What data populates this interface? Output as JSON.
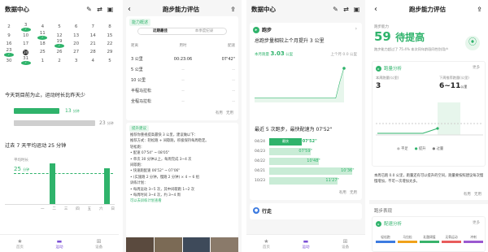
{
  "p1": {
    "title": "数据中心",
    "calendar": [
      [
        "2",
        "3",
        "4",
        "5",
        "6",
        "7",
        "8"
      ],
      [
        "9",
        "10",
        "11",
        "12",
        "13",
        "14",
        "15"
      ],
      [
        "16",
        "17",
        "18",
        "19",
        "20",
        "21",
        "22"
      ],
      [
        "23",
        "24",
        "25",
        "26",
        "27",
        "28",
        "29"
      ],
      [
        "30",
        "31",
        "1",
        "2",
        "3",
        "4",
        "5"
      ]
    ],
    "checked_days": [
      "3",
      "11",
      "19",
      "23",
      "31"
    ],
    "today": "24",
    "summary_text": "今天到目前为止，运动时长比昨天少",
    "today_label": "今日",
    "today_value": "13",
    "today_unit": "分钟",
    "yesterday_label": "昨日",
    "yesterday_value": "23",
    "yesterday_unit": "分钟",
    "week_title": "过去 7 天平均运动 25 分钟",
    "avg_label": "平均时长",
    "avg_value": "25",
    "avg_unit": "分钟",
    "weekdays": [
      "一",
      "二",
      "三",
      "四",
      "五",
      "六",
      "日"
    ],
    "nav": [
      "首页",
      "运动",
      "设备"
    ]
  },
  "p2": {
    "title": "跑步能力评估",
    "badge": "能力概述",
    "tabs": [
      "近期最佳",
      "本季度纪录"
    ],
    "col_headers": [
      "距离",
      "用时",
      "配速"
    ],
    "rows": [
      {
        "dist": "3 公里",
        "time": "00:23:06",
        "pace": "07'42\""
      },
      {
        "dist": "5 公里",
        "time": "--",
        "pace": "--"
      },
      {
        "dist": "10 公里",
        "time": "--",
        "pace": "--"
      },
      {
        "dist": "半程马拉松",
        "time": "--",
        "pace": "--"
      },
      {
        "dist": "全程马拉松",
        "time": "--",
        "pace": "--"
      }
    ],
    "like": "有用",
    "dislike": "无用",
    "guide_badge": "提升建议",
    "p1": "推荐你重视提高最快 3 公里，建议做以下：",
    "p2": "推荐方式：轻松跑 + 间歇跑，积极保持每周稳定。",
    "p3": "轻松跑：",
    "p4": "• 配速 07'54\" ~ 08'05\"",
    "p5": "• 单次 30 分钟以上，每周完成 3~4 次",
    "p6": "间歇跑：",
    "p7": "• 快速跑配速 06'52\" ~ 07'06\"",
    "p8": "• (实施跑 2 分钟，慢跑 2 分钟) × 4 ~ 6 组",
    "p9": "训练计划：",
    "p10": "• 每周运动 3~5 次，其中间歇跑 1~2 次",
    "p11": "• 每周时间 3~4 次，约 3~4 周",
    "p12": "可以去训练计划查看"
  },
  "p3": {
    "title": "数据中心",
    "section": "跑步",
    "headline": "总跑步量相较上个月提升 3 公里",
    "month_label": "本月跑量",
    "month_value": "3.03",
    "month_unit": "公里",
    "prev_label": "上个月 0.0 公里",
    "recent_title": "最近 5 次跑步，最快配速为 07'52\"",
    "recent_badge": "最快",
    "runs": [
      {
        "date": "04/24",
        "pace": "07'52\"",
        "frac": 0.36,
        "fast": true
      },
      {
        "date": "04/23",
        "pace": "07'59\"",
        "frac": 0.46,
        "fast": false
      },
      {
        "date": "04/22",
        "pace": "10'48\"",
        "frac": 0.55,
        "fast": false
      },
      {
        "date": "04/21",
        "pace": "10'36\"",
        "frac": 0.93,
        "fast": false
      },
      {
        "date": "10/23",
        "pace": "11'27\"",
        "frac": 0.76,
        "fast": false
      }
    ],
    "like": "有用",
    "dislike": "无用",
    "walk": "行走",
    "nav": [
      "首页",
      "运动",
      "设备"
    ]
  },
  "p4": {
    "title": "跑步能力评估",
    "score_label": "跑步能力",
    "score": "59",
    "level": "待提高",
    "rank": "跑步能力超过了 75.4% 本次同年龄段同性别用户",
    "trend_title": "跑量分析",
    "more": "更多",
    "this_week_label": "本周跑量(公里)",
    "this_week": "3",
    "next_week_label": "下周推荐跑量(公里)",
    "next_week": "6~11",
    "next_week_unit": "公里",
    "legend": [
      "平足",
      "提升",
      "过量"
    ],
    "advice": "本周已跑 0.0 公里，跑量还有可以提升的空间，跑量要按照建议每次慢慢增加，不可一次增加太多。",
    "like": "有用",
    "dislike": "无用",
    "perf_title": "跑步表现",
    "fastest_label": "配速分析",
    "zones": [
      "轻松跑",
      "马拉松",
      "乳酸阈值",
      "无氧运动",
      "冲刺"
    ],
    "zone_colors": [
      "#3d7be0",
      "#f0a21b",
      "#39b36b",
      "#e85c5c",
      "#9b59d0"
    ]
  }
}
